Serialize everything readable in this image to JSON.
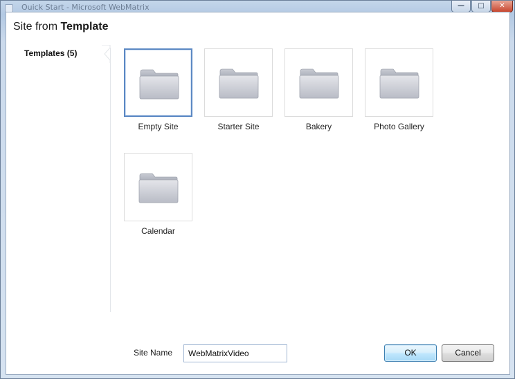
{
  "window": {
    "title": "Quick Start - Microsoft WebMatrix",
    "controls": {
      "minimize": "—",
      "maximize": "□",
      "close": "✕"
    }
  },
  "dialog": {
    "title_prefix": "Site from ",
    "title_bold": "Template"
  },
  "nav": {
    "items": [
      {
        "label": "Templates (5)",
        "selected": true
      }
    ]
  },
  "templates": [
    {
      "label": "Empty Site",
      "selected": true
    },
    {
      "label": "Starter Site",
      "selected": false
    },
    {
      "label": "Bakery",
      "selected": false
    },
    {
      "label": "Photo Gallery",
      "selected": false
    },
    {
      "label": "Calendar",
      "selected": false
    }
  ],
  "footer": {
    "site_name_label": "Site Name",
    "site_name_value": "WebMatrixVideo",
    "ok_label": "OK",
    "cancel_label": "Cancel"
  },
  "icons": {
    "template_icon": "folder-icon"
  }
}
